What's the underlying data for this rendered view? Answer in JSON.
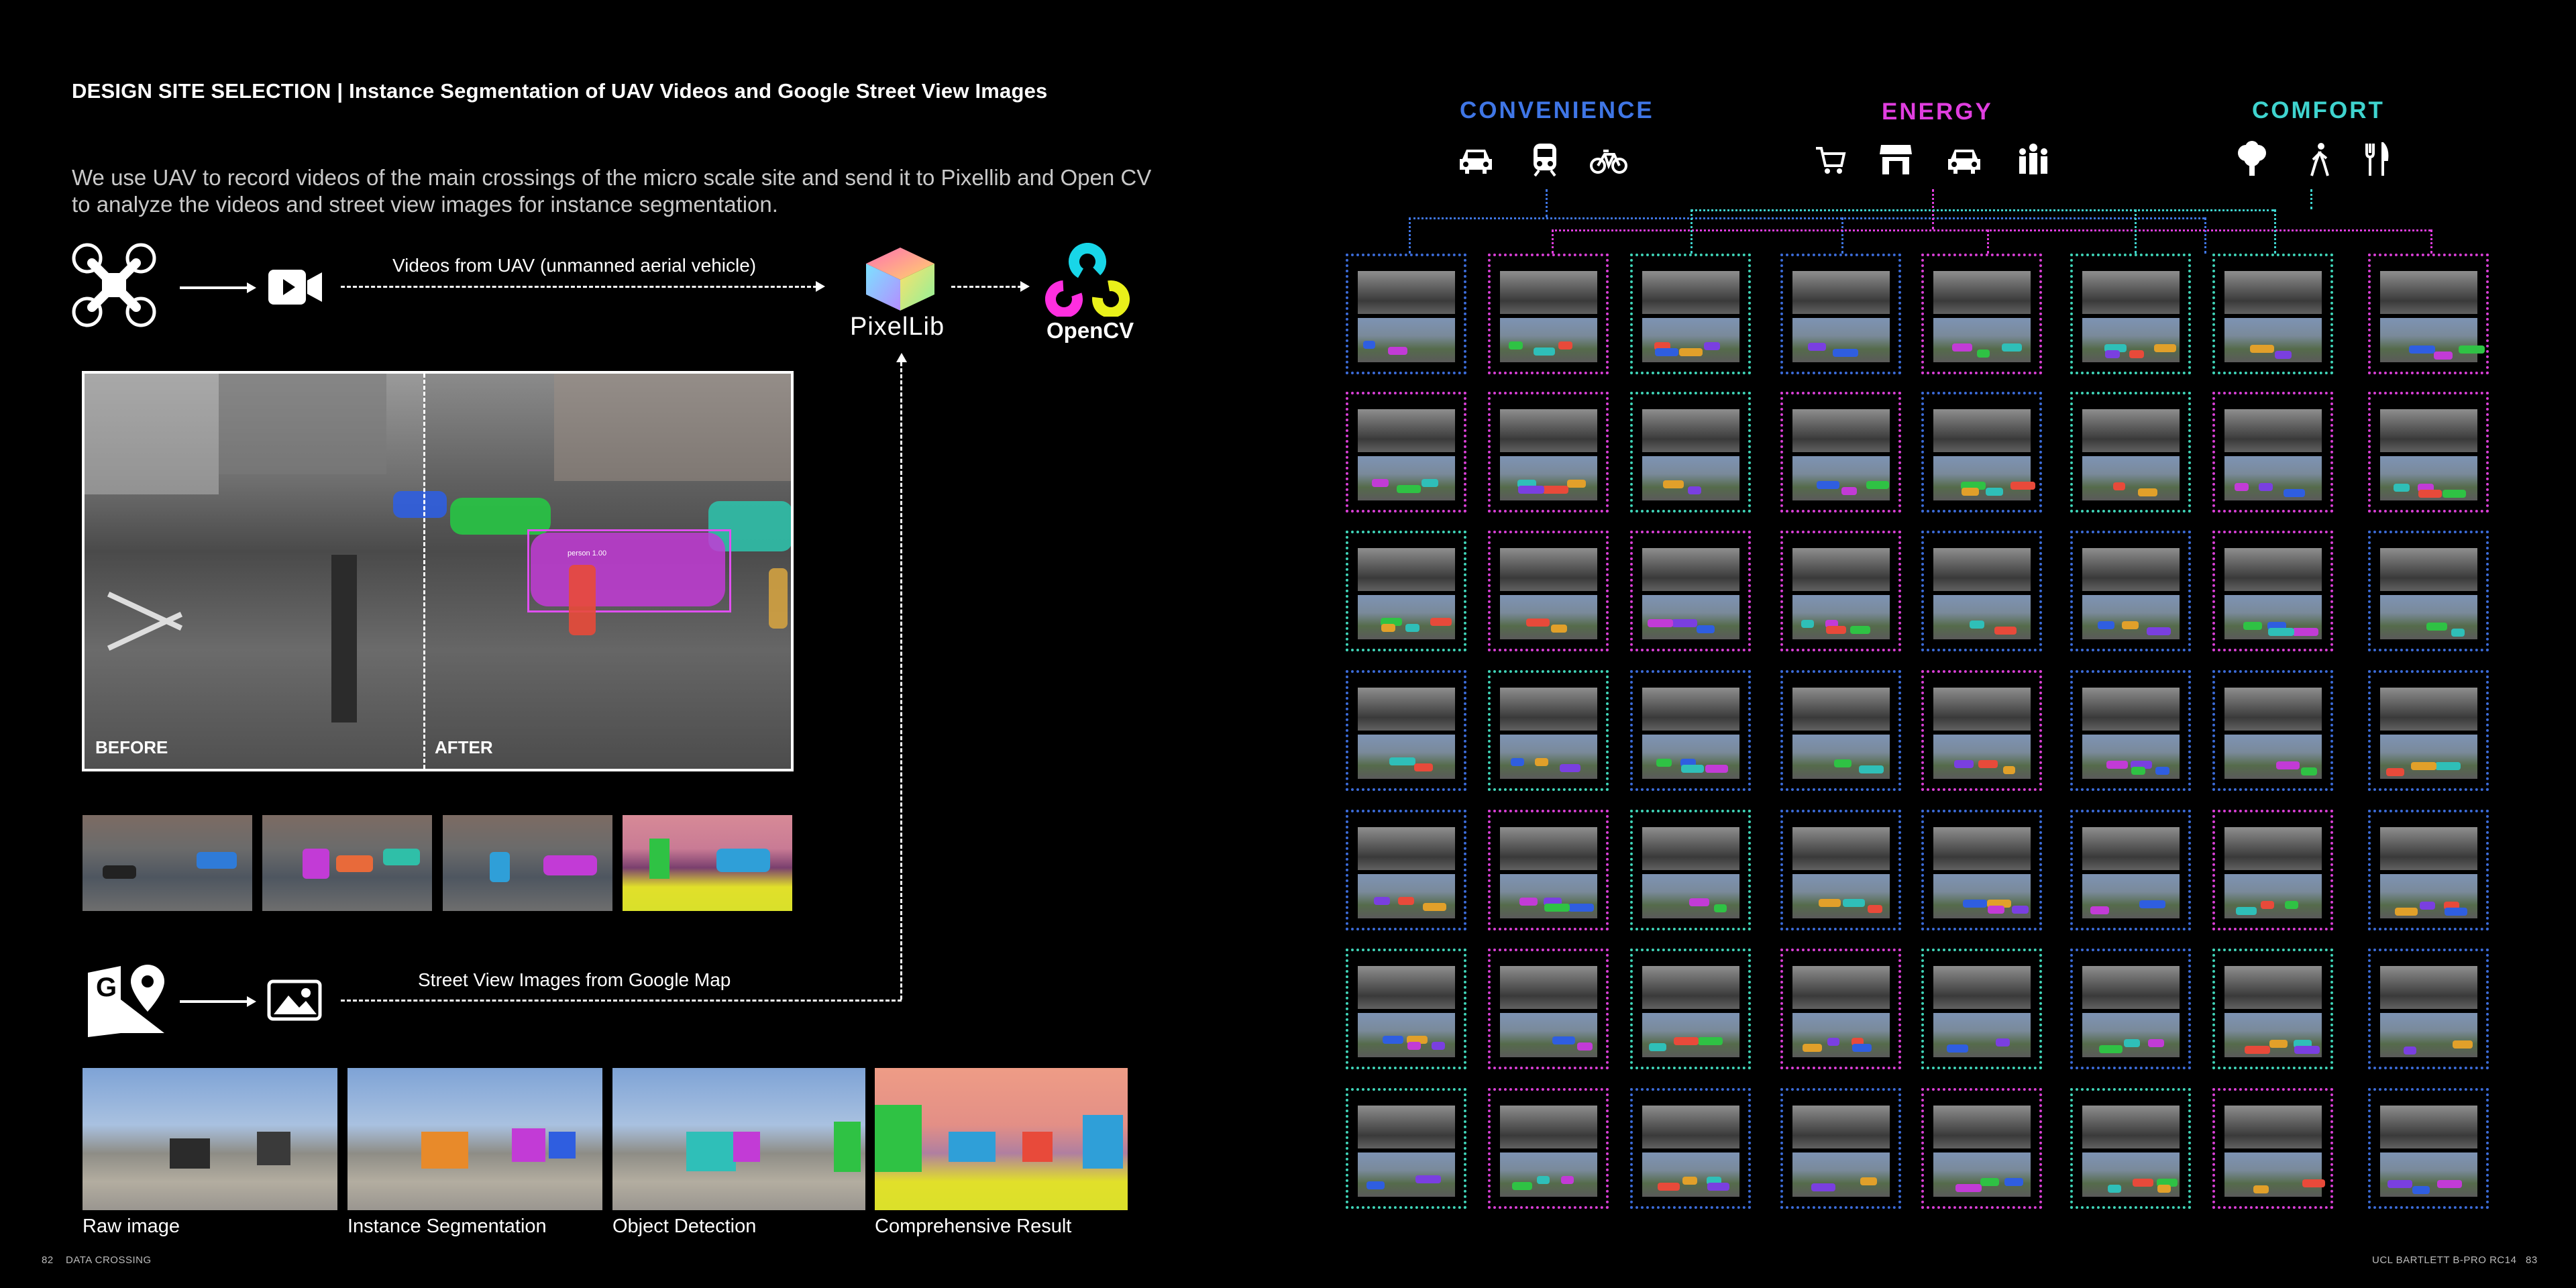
{
  "header": {
    "title": "DESIGN SITE SELECTION | Instance Segmentation of UAV Videos and Google Street View Images",
    "intro": "We use UAV to record videos of the main crossings of the micro scale site and send it to Pixellib and Open CV to analyze the videos and street view images for instance segmentation."
  },
  "flow": {
    "uav_label": "Videos from UAV (unmanned aerial vehicle)",
    "gsv_label": "Street View Images from Google Map",
    "pixellib": "PixelLib",
    "opencv": "OpenCV",
    "icons": [
      "drone-icon",
      "video-camera-icon",
      "google-maps-icon",
      "image-icon"
    ]
  },
  "main_image": {
    "before": "BEFORE",
    "after": "AFTER",
    "detection_tag": "person 1.00"
  },
  "results": {
    "captions": [
      "Raw image",
      "Instance Segmentation",
      "Object Detection",
      "Comprehensive Result"
    ]
  },
  "categories": [
    {
      "name": "CONVENIENCE",
      "color": "#3f76e6",
      "icons": [
        "car-icon",
        "train-icon",
        "bicycle-icon"
      ]
    },
    {
      "name": "ENERGY",
      "color": "#e13ee0",
      "icons": [
        "shopping-cart-icon",
        "shop-icon",
        "car-icon",
        "crowd-icon"
      ]
    },
    {
      "name": "COMFORT",
      "color": "#3fd4cf",
      "icons": [
        "tree-icon",
        "pedestrian-icon",
        "restaurant-icon"
      ]
    }
  ],
  "grid": {
    "rows": 7,
    "cols": 8,
    "cell_colors": [
      [
        "blue",
        "magenta",
        "green",
        "blue",
        "magenta",
        "green",
        "green",
        "magenta"
      ],
      [
        "magenta",
        "magenta",
        "green",
        "magenta",
        "blue",
        "green",
        "magenta",
        "magenta"
      ],
      [
        "green",
        "magenta",
        "magenta",
        "magenta",
        "blue",
        "blue",
        "magenta",
        "blue"
      ],
      [
        "blue",
        "green",
        "blue",
        "blue",
        "magenta",
        "blue",
        "blue",
        "blue"
      ],
      [
        "blue",
        "magenta",
        "green",
        "blue",
        "blue",
        "blue",
        "magenta",
        "blue"
      ],
      [
        "green",
        "magenta",
        "green",
        "magenta",
        "green",
        "blue",
        "green",
        "blue"
      ],
      [
        "green",
        "magenta",
        "blue",
        "blue",
        "magenta",
        "green",
        "magenta",
        "blue"
      ]
    ],
    "palette": {
      "blue": "#3b6bd8",
      "magenta": "#d93fd6",
      "green": "#3fd4b8"
    }
  },
  "footer": {
    "left_page": "82",
    "left_label": "DATA CROSSING",
    "right_label": "UCL BARTLETT B-PRO RC14",
    "right_page": "83"
  }
}
